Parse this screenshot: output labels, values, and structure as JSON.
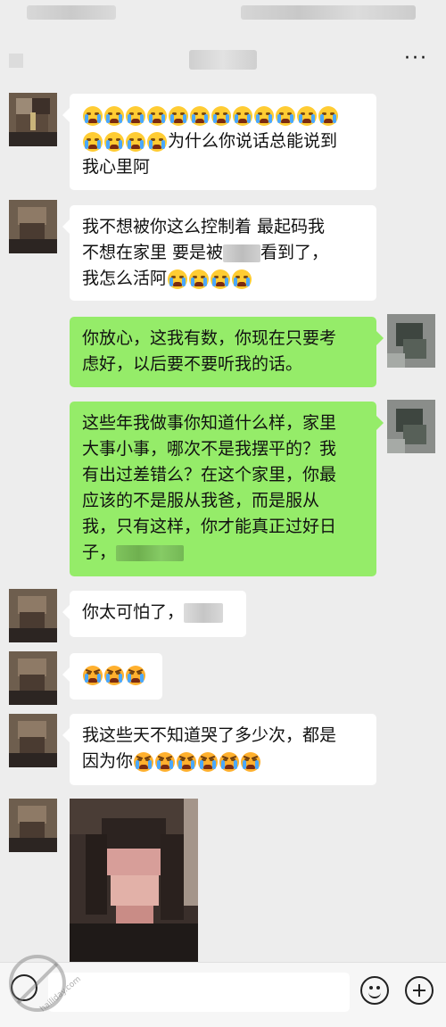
{
  "header": {
    "more_label": "···"
  },
  "messages": [
    {
      "id": "m1",
      "side": "in",
      "text_a": "",
      "text_b": "为什么你说话总能说到",
      "text_c": "我心里阿",
      "emoji": "loudly-crying-face-icon",
      "emoji_count": 16
    },
    {
      "id": "m2",
      "side": "in",
      "line1": "我不想被你这么控制着  最起码我",
      "line2_a": "不想在家里   要是被",
      "line2_b": "看到了，",
      "line3": "我怎么活阿",
      "emoji": "loudly-crying-face-icon",
      "emoji_count": 4
    },
    {
      "id": "m3",
      "side": "out",
      "line1": "你放心，这我有数，你现在只要考",
      "line2": "虑好，以后要不要听我的话。"
    },
    {
      "id": "m4",
      "side": "out",
      "line1": "这些年我做事你知道什么样，家里",
      "line2": "大事小事，哪次不是我摆平的？我",
      "line3": "有出过差错么？在这个家里，你最",
      "line4": "应该的不是服从我爸，而是服从",
      "line5": "我，只有这样，你才能真正过好日",
      "line6": "子，"
    },
    {
      "id": "m5",
      "side": "in",
      "text": "你太可怕了，"
    },
    {
      "id": "m6",
      "side": "in",
      "emoji": "pouting-crying-face-icon",
      "emoji_count": 3
    },
    {
      "id": "m7",
      "side": "in",
      "line1": "我这些天不知道哭了多少次，都是",
      "line2": "因为你",
      "emoji": "pouting-crying-face-icon",
      "emoji_count": 6
    }
  ],
  "input_bar": {
    "voice_icon": "voice-icon",
    "emoji_icon": "emoji-icon",
    "plus_icon": "plus-icon"
  },
  "watermark": {
    "text": "hailiday.com"
  },
  "colors": {
    "background": "#ededed",
    "bubble_in": "#ffffff",
    "bubble_out": "#95ec69"
  }
}
